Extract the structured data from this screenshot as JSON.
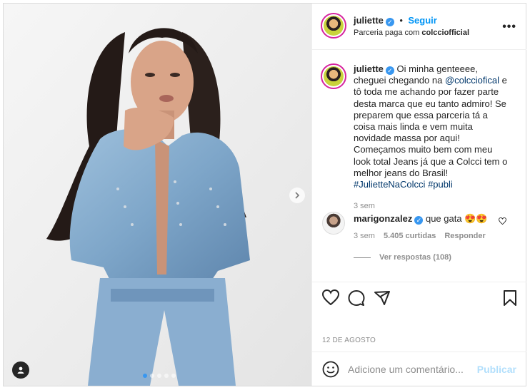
{
  "post": {
    "author": "juliette",
    "follow_label": "Seguir",
    "partnership_prefix": "Parceria paga com",
    "partner": "colcciofficial",
    "more_label": "•••"
  },
  "caption": {
    "author": "juliette",
    "text_1": " Oi minha genteeee, cheguei chegando na ",
    "mention": "@colcciofical",
    "text_2": " e tô toda me achando por fazer parte desta marca que eu tanto admiro! Se preparem que essa parceria tá a coisa mais linda e vem muita novidade massa por aqui! Começamos muito bem com meu look total Jeans já que a Colcci tem o melhor jeans do Brasil! ",
    "hashtag_1": "#JulietteNaColcci",
    "hashtag_2": "#publi",
    "time": "3 sem"
  },
  "comment": {
    "author": "marigonzalez",
    "text": " que gata 😍😍",
    "time": "3 sem",
    "likes": "5.405 curtidas",
    "reply_label": "Responder",
    "view_replies": "Ver respostas (108)"
  },
  "date": "12 DE AGOSTO",
  "add_comment": {
    "placeholder": "Adicione um comentário...",
    "post_label": "Publicar"
  },
  "carousel": {
    "count": 5,
    "active": 0
  },
  "colors": {
    "accent": "#0095f6",
    "verified": "#3897f0",
    "muted": "#8e8e8e"
  },
  "icons": [
    "verified-badge-icon",
    "more-options-icon",
    "heart-icon",
    "comment-icon",
    "share-icon",
    "bookmark-icon",
    "emoji-icon",
    "chevron-right-icon",
    "user-tag-icon"
  ]
}
